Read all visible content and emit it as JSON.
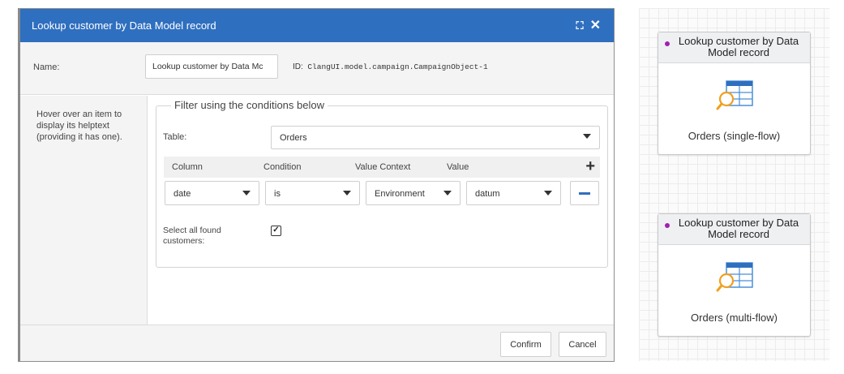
{
  "dialog": {
    "title": "Lookup customer by Data Model record",
    "name_label": "Name:",
    "name_value": "Lookup customer by Data Mc",
    "id_prefix": "ID:",
    "id_value": "ClangUI.model.campaign.CampaignObject-1",
    "help_text": "Hover over an item to display its helptext (providing it has one).",
    "filter": {
      "legend": "Filter using the conditions below",
      "table_label": "Table:",
      "table_value": "Orders",
      "columns": [
        "Column",
        "Condition",
        "Value Context",
        "Value"
      ],
      "conditions": [
        {
          "column": "date",
          "condition": "is",
          "value_context": "Environment",
          "value": "datum"
        }
      ],
      "select_all_label": "Select all found customers:",
      "select_all_checked": true
    },
    "buttons": {
      "confirm": "Confirm",
      "cancel": "Cancel"
    }
  },
  "canvas": {
    "nodes": [
      {
        "title": "Lookup customer by Data Model record",
        "label": "Orders (single-flow)",
        "dot_color": "#a020b0"
      },
      {
        "title": "Lookup customer by Data Model record",
        "label": "Orders (multi-flow)",
        "dot_color": "#a020b0"
      }
    ]
  },
  "colors": {
    "header": "#2f6fbf",
    "accent": "#2f6fbf",
    "node_dot": "#a020b0"
  }
}
